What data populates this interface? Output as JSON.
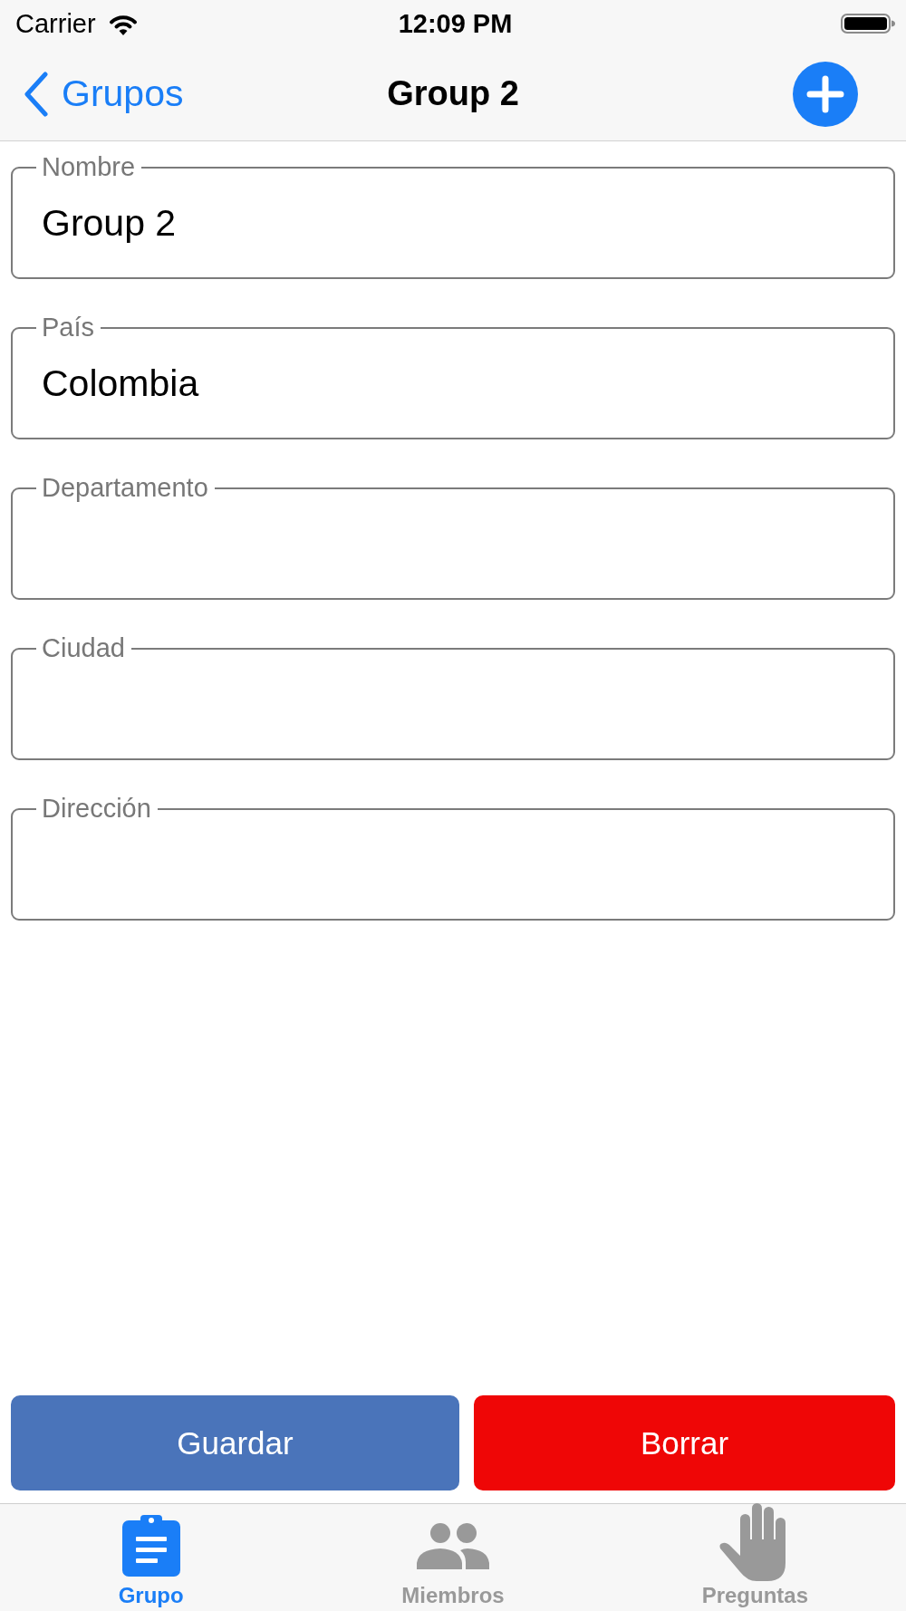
{
  "status_bar": {
    "carrier": "Carrier",
    "time": "12:09 PM"
  },
  "nav_bar": {
    "back": "Grupos",
    "title": "Group 2"
  },
  "fields": [
    {
      "label": "Nombre",
      "value": "Group 2"
    },
    {
      "label": "País",
      "value": "Colombia"
    },
    {
      "label": "Departamento"
    },
    {
      "label": "Ciudad"
    },
    {
      "label": "Dirección"
    }
  ],
  "buttons": [
    {
      "label": "Guardar",
      "color": "#4a74ba"
    },
    {
      "label": "Borrar",
      "color": "#ef0606"
    }
  ],
  "tab_bar": [
    {
      "label": "Grupo",
      "kind": "clipboard",
      "selected": true
    },
    {
      "label": "Miembros",
      "kind": "people",
      "selected": false
    },
    {
      "label": "Preguntas",
      "kind": "hand",
      "selected": false
    }
  ]
}
